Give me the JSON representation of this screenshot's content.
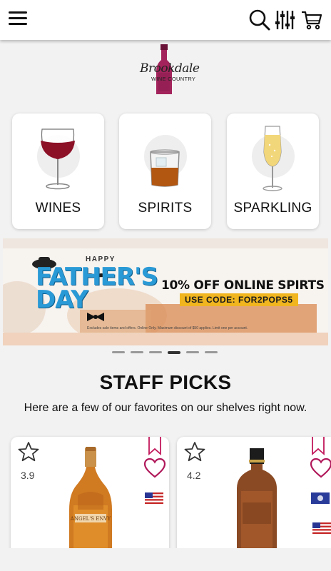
{
  "header": {
    "menu_icon": "hamburger-menu-icon",
    "search_icon": "search-icon",
    "filter_icon": "filter-sliders-icon",
    "cart_icon": "shopping-cart-icon"
  },
  "logo": {
    "script": "Brookdale",
    "sub": "WINE COUNTRY"
  },
  "categories": [
    {
      "label": "WINES",
      "icon": "red-wine-glass-icon"
    },
    {
      "label": "SPIRITS",
      "icon": "whiskey-glass-icon"
    },
    {
      "label": "SPARKLING",
      "icon": "champagne-flute-icon"
    }
  ],
  "banner": {
    "happy": "HAPPY",
    "title_line1": "FATHER'S",
    "title_line2": "DAY",
    "offer": "10% OFF ONLINE SPIRTS",
    "code": "USE CODE: FOR2POPS5",
    "fine_print": "Excludes sale items and offers. Online Only. Maximum discount of $50 applies. Limit one per account.",
    "colors": {
      "title": "#2a9ad6",
      "code_bg": "#f0b51f"
    }
  },
  "carousel": {
    "count": 6,
    "active_index": 3
  },
  "staff_picks": {
    "title": "STAFF PICKS",
    "subtitle": "Here are a few of our favorites on our shelves right now."
  },
  "products": [
    {
      "rating": "3.9",
      "bottle_label": "ANGEL'S ENVY",
      "flags": [
        "us-flag-icon"
      ]
    },
    {
      "rating": "4.2",
      "bottle_label": "",
      "flags": [
        "kentucky-flag-icon",
        "us-flag-icon"
      ]
    }
  ],
  "colors": {
    "accent": "#b0185a",
    "bookmark": "#c2185b"
  }
}
